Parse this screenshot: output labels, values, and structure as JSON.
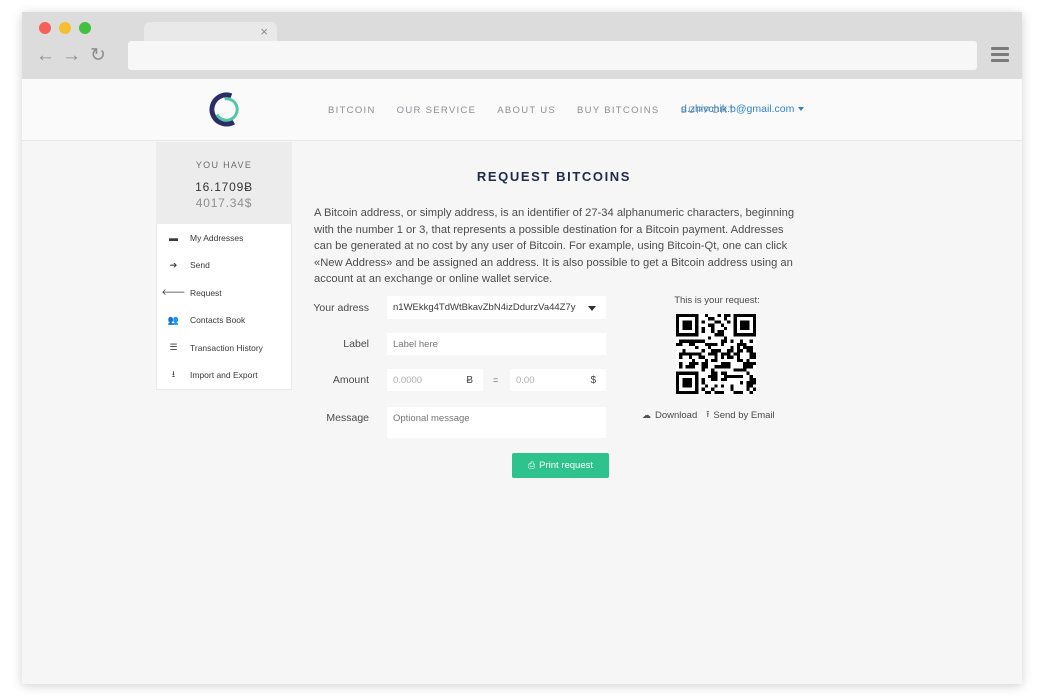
{
  "browser": {
    "tab_close": "×",
    "back_icon": "←",
    "forward_icon": "→",
    "reload_icon": "↻"
  },
  "header": {
    "nav": [
      "BITCOIN",
      "OUR SERVICE",
      "ABOUT US",
      "BUY BITCOINS",
      "SUPPORT"
    ],
    "user_email": "d.zhivchik.b@gmail.com"
  },
  "balance": {
    "label": "YOU HAVE",
    "btc": "16.1709Ƀ",
    "usd": "4017.34$"
  },
  "sidebar": {
    "items": [
      {
        "label": "My Addresses",
        "icon": "briefcase-icon",
        "glyph": "▬"
      },
      {
        "label": "Send",
        "icon": "arrow-right-icon",
        "glyph": "➔"
      },
      {
        "label": "Request",
        "icon": "arrow-left-icon",
        "glyph": "🡐"
      },
      {
        "label": "Contacts Book",
        "icon": "users-icon",
        "glyph": "👥"
      },
      {
        "label": "Transaction History",
        "icon": "list-icon",
        "glyph": "☰"
      },
      {
        "label": "Import and Export",
        "icon": "download-icon",
        "glyph": "⭳"
      }
    ]
  },
  "main": {
    "title": "REQUEST BITCOINS",
    "description": "A Bitcoin address, or simply address, is an identifier of 27-34 alphanumeric characters, beginning with the number 1 or 3, that represents a possible destination for a Bitcoin payment. Addresses can be generated at no cost by any user of Bitcoin. For example, using Bitcoin-Qt, one can click «New Address» and be assigned an address. It is also possible to get a Bitcoin address using an account at an exchange or online wallet service.",
    "form": {
      "address_label": "Your adress",
      "address_value": "n1WEkkg4TdWtBkavZbN4izDdurzVa44Z7y",
      "label_label": "Label",
      "label_placeholder": "Label here",
      "amount_label": "Amount",
      "amount_btc_placeholder": "0.0000",
      "btc_symbol": "Ƀ",
      "equals": "=",
      "amount_usd_placeholder": "0.00",
      "usd_symbol": "$",
      "message_label": "Message",
      "message_placeholder": "Optional message",
      "print_label": "Print request"
    },
    "qr": {
      "caption": "This is your request:",
      "download_label": "Download",
      "email_label": "Send by Email"
    }
  },
  "colors": {
    "accent": "#2ec28c",
    "link": "#2f86c9",
    "title": "#1e2b4a"
  }
}
